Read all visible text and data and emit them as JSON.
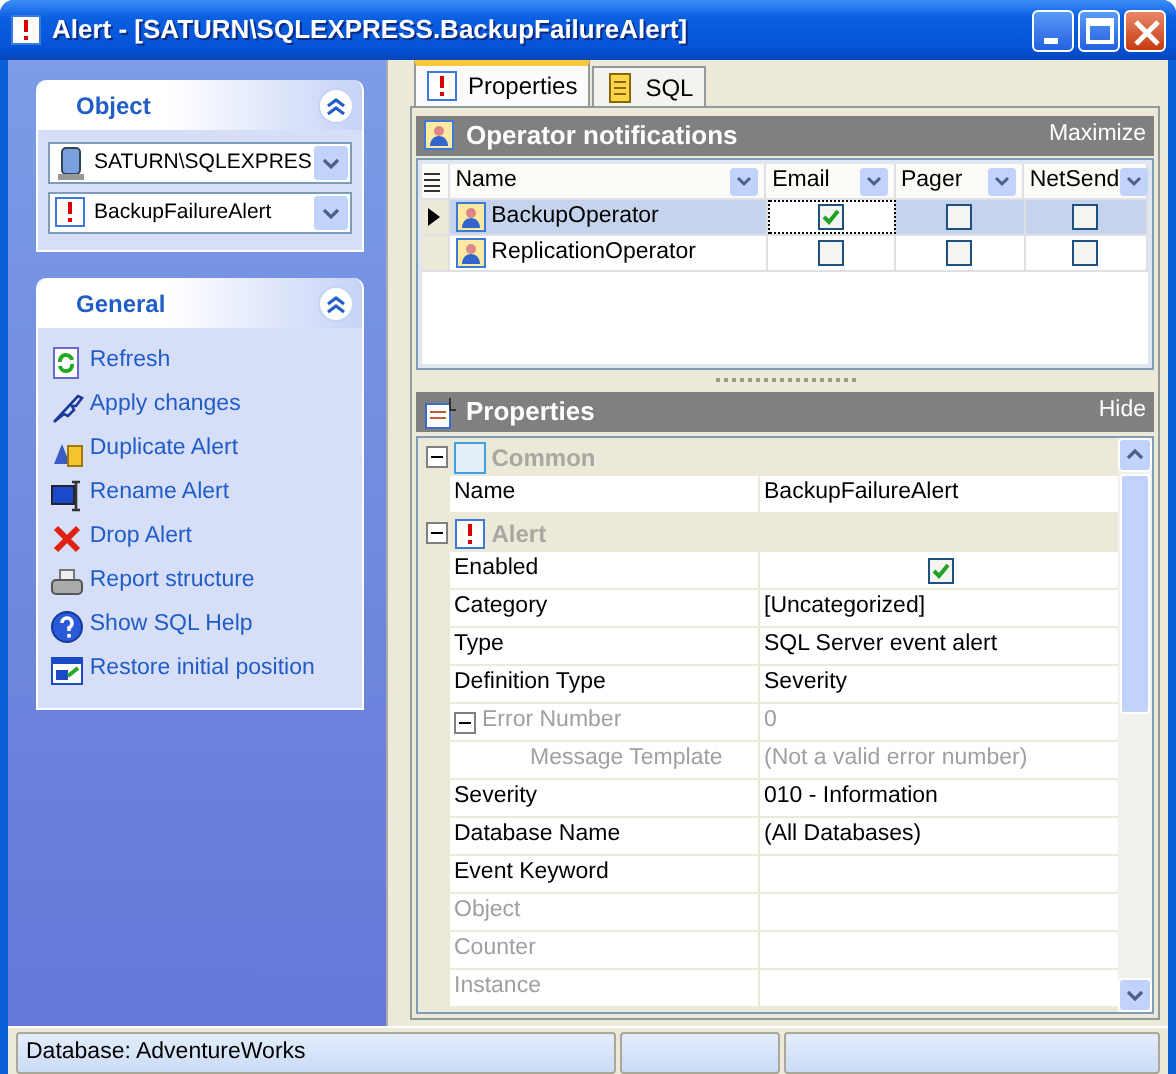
{
  "window": {
    "title": "Alert - [SATURN\\SQLEXPRESS.BackupFailureAlert]"
  },
  "sidebar": {
    "panels": [
      {
        "title": "Object",
        "expanded": true,
        "kind": "combos",
        "items": [
          {
            "label": "SATURN\\SQLEXPRES"
          },
          {
            "label": "BackupFailureAlert"
          }
        ]
      },
      {
        "title": "General",
        "expanded": true,
        "kind": "links",
        "items": [
          {
            "label": "Refresh"
          },
          {
            "label": "Apply changes"
          },
          {
            "label": "Duplicate Alert"
          },
          {
            "label": "Rename Alert"
          },
          {
            "label": "Drop Alert"
          },
          {
            "label": "Report structure"
          },
          {
            "label": "Show SQL Help"
          },
          {
            "label": "Restore initial position"
          }
        ]
      }
    ]
  },
  "tabs": [
    {
      "label": "Properties",
      "selected": true
    },
    {
      "label": "SQL",
      "selected": false
    }
  ],
  "operators": {
    "title": "Operator notifications",
    "link": "Maximize",
    "columns": [
      "Name",
      "Email",
      "Pager",
      "NetSend"
    ],
    "rows": [
      {
        "name": "BackupOperator",
        "selected": true,
        "email": true,
        "pager": false,
        "netsend": false
      },
      {
        "name": "ReplicationOperator",
        "selected": false,
        "email": false,
        "pager": false,
        "netsend": false
      }
    ]
  },
  "properties": {
    "title": "Properties",
    "link": "Hide",
    "groups": [
      {
        "title": "Common",
        "expanded": true,
        "rows": [
          {
            "name": "Name",
            "value": "BackupFailureAlert",
            "disabled": false
          }
        ]
      },
      {
        "title": "Alert",
        "expanded": true,
        "rows": [
          {
            "name": "Enabled",
            "kind": "checkbox",
            "checked": true,
            "disabled": false
          },
          {
            "name": "Category",
            "value": "[Uncategorized]",
            "disabled": false
          },
          {
            "name": "Type",
            "value": "SQL Server event alert",
            "disabled": false
          },
          {
            "name": "Definition Type",
            "value": "Severity",
            "disabled": false
          },
          {
            "name": "Error Number",
            "value": "0",
            "disabled": true,
            "expanded": true,
            "children": [
              {
                "name": "Message Template",
                "value": "(Not a valid error number)",
                "disabled": true
              }
            ]
          },
          {
            "name": "Severity",
            "value": "010 - Information",
            "disabled": false
          },
          {
            "name": "Database Name",
            "value": "(All Databases)",
            "disabled": false
          },
          {
            "name": "Event Keyword",
            "disabled": false
          },
          {
            "name": "Object",
            "disabled": true
          },
          {
            "name": "Counter",
            "disabled": true
          },
          {
            "name": "Instance",
            "disabled": true
          }
        ]
      }
    ]
  },
  "status_bar": {
    "text": "Database: AdventureWorks"
  }
}
